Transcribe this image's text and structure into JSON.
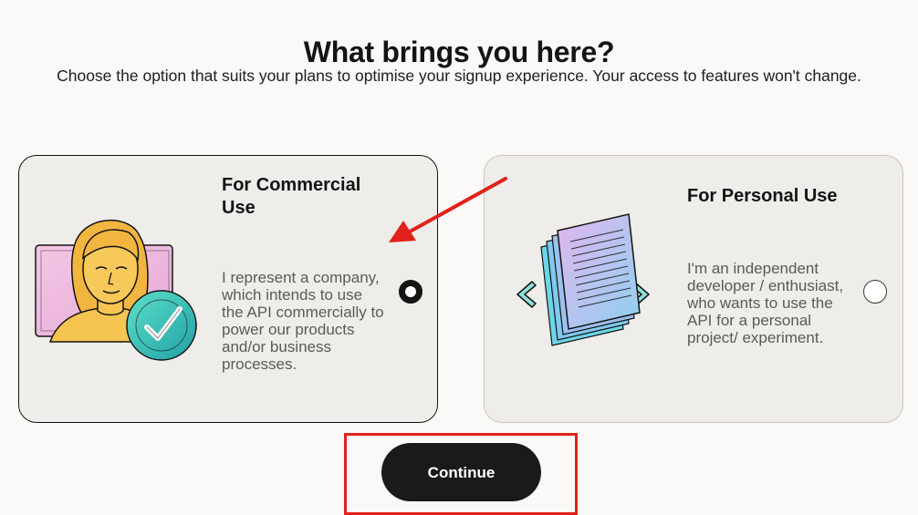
{
  "header": {
    "title": "What brings you here?",
    "subtitle": "Choose the option that suits your plans to optimise your signup experience. Your access to features won't change."
  },
  "options": [
    {
      "title": "For Commercial Use",
      "description": "I represent a company, which intends to use the API commercially to power our products and/or business processes.",
      "selected": true,
      "illustration": "person-with-checkmark-icon"
    },
    {
      "title": "For Personal Use",
      "description": "I'm an independent developer / enthusiast, who wants to use the API for a personal project/ experiment.",
      "selected": false,
      "illustration": "document-stack-icon"
    }
  ],
  "actions": {
    "continue_label": "Continue"
  },
  "colors": {
    "background": "#faf9f7",
    "card_background": "#efede9",
    "button": "#1c1a19",
    "annotation": "#e0211c"
  }
}
